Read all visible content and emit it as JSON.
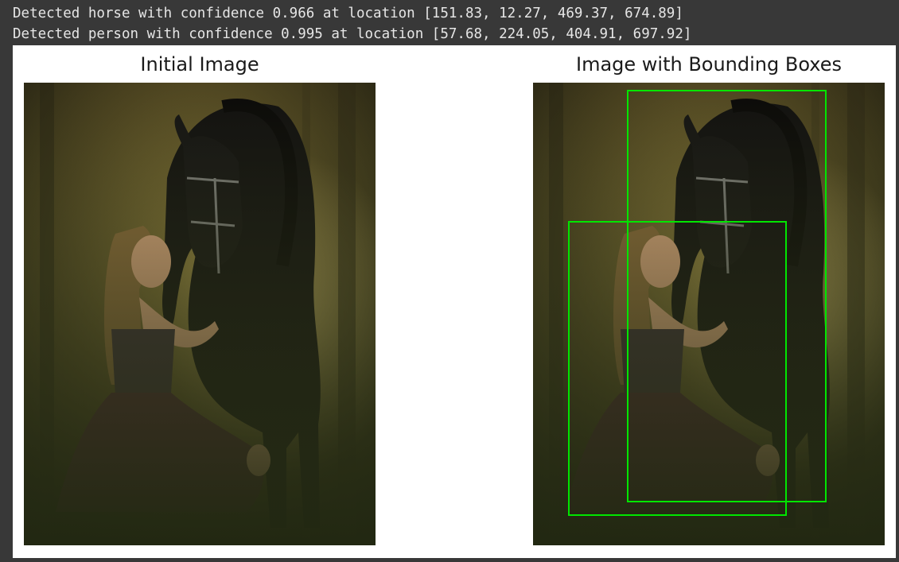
{
  "output": {
    "lines": [
      "Detected horse with confidence 0.966 at location [151.83, 12.27, 469.37, 674.89]",
      "Detected person with confidence 0.995 at location [57.68, 224.05, 404.91, 697.92]"
    ]
  },
  "figure": {
    "left_title": "Initial Image",
    "right_title": "Image with Bounding Boxes",
    "box_color": "#00e600"
  }
}
